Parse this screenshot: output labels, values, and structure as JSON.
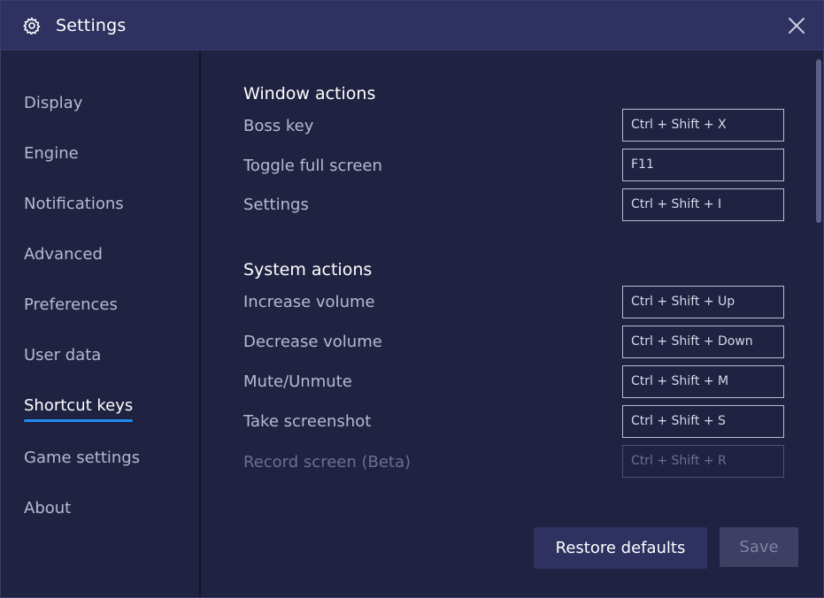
{
  "titlebar": {
    "title": "Settings",
    "icon": "gear-icon",
    "close_icon": "close-icon"
  },
  "sidebar": {
    "items": [
      {
        "label": "Display"
      },
      {
        "label": "Engine"
      },
      {
        "label": "Notifications"
      },
      {
        "label": "Advanced"
      },
      {
        "label": "Preferences"
      },
      {
        "label": "User data"
      },
      {
        "label": "Shortcut keys"
      },
      {
        "label": "Game settings"
      },
      {
        "label": "About"
      }
    ],
    "active": "Shortcut keys"
  },
  "window_actions": {
    "title": "Window actions",
    "rows": [
      {
        "label": "Boss key",
        "keys": "Ctrl + Shift + X"
      },
      {
        "label": "Toggle full screen",
        "keys": "F11"
      },
      {
        "label": "Settings",
        "keys": "Ctrl + Shift + I"
      }
    ]
  },
  "system_actions": {
    "title": "System actions",
    "rows": [
      {
        "label": "Increase volume",
        "keys": "Ctrl + Shift + Up"
      },
      {
        "label": "Decrease volume",
        "keys": "Ctrl + Shift + Down"
      },
      {
        "label": "Mute/Unmute",
        "keys": "Ctrl + Shift + M"
      },
      {
        "label": "Take screenshot",
        "keys": "Ctrl + Shift + S"
      },
      {
        "label": "Record screen (Beta)",
        "keys": "Ctrl + Shift + R"
      }
    ]
  },
  "buttons": {
    "restore": "Restore defaults",
    "save": "Save"
  },
  "colors": {
    "background": "#202241",
    "titlebar": "#2f3260",
    "accent": "#1f8cf0"
  }
}
